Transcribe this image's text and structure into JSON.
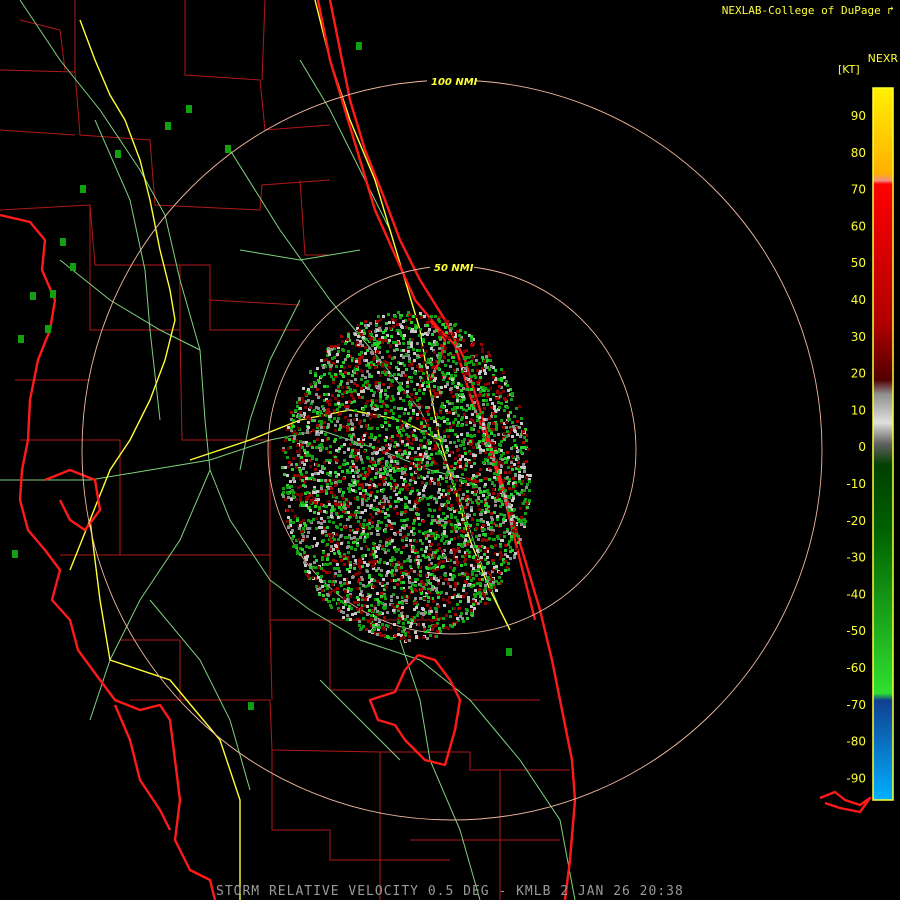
{
  "credit": "NEXLAB-College of DuPage",
  "credit_icon": "cursor-arrow-icon",
  "product_code": "NEXR",
  "unit_label": "[KT]",
  "caption": "STORM RELATIVE VELOCITY 0.5 DEG - KMLB 2 JAN 26 20:38",
  "range_rings": [
    {
      "label": "50 NMI",
      "range_nmi": 50
    },
    {
      "label": "100 NMI",
      "range_nmi": 100
    }
  ],
  "legend_ticks": [
    "90",
    "80",
    "70",
    "60",
    "50",
    "40",
    "30",
    "20",
    "10",
    "0",
    "-10",
    "-20",
    "-30",
    "-40",
    "-50",
    "-60",
    "-70",
    "-80",
    "-90"
  ],
  "colors": {
    "background": "#000000",
    "coastline": "#ff1a1a",
    "county_lines": "#b01818",
    "highways": "#ffff33",
    "roads": "#7fd27f",
    "range_rings": "#f0b8a0",
    "outbound": "#a00000",
    "inbound": "#10a010",
    "near_zero": "#c8c8c8"
  }
}
